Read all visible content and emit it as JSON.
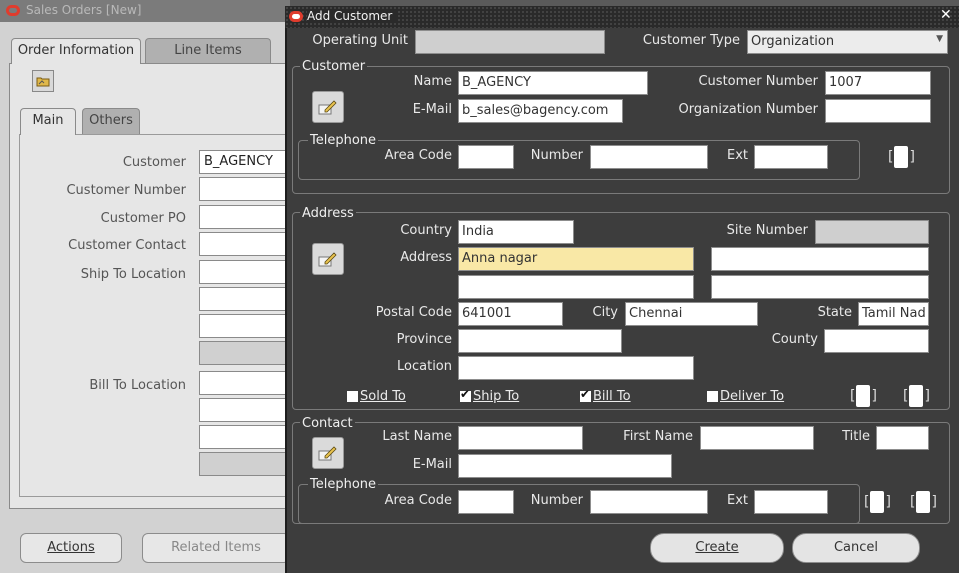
{
  "background_window": {
    "title": "Sales Orders [New]",
    "tabs": [
      "Order Information",
      "Line Items"
    ],
    "sub_tabs": [
      "Main",
      "Others"
    ],
    "labels": {
      "customer": "Customer",
      "customer_number": "Customer Number",
      "customer_po": "Customer PO",
      "customer_contact": "Customer Contact",
      "ship_to_location": "Ship To Location",
      "bill_to_location": "Bill To Location"
    },
    "values": {
      "customer": "B_AGENCY"
    },
    "buttons": {
      "actions": "Actions",
      "related_items": "Related Items"
    }
  },
  "dialog": {
    "title": "Add Customer",
    "operating_unit": {
      "label": "Operating Unit",
      "value": ""
    },
    "customer_type": {
      "label": "Customer Type",
      "value": "Organization"
    },
    "customer": {
      "group_title": "Customer",
      "name": {
        "label": "Name",
        "value": "B_AGENCY"
      },
      "email": {
        "label": "E-Mail",
        "value": "b_sales@bagency.com"
      },
      "customer_number": {
        "label": "Customer Number",
        "value": "1007"
      },
      "organization_number": {
        "label": "Organization Number",
        "value": ""
      },
      "telephone": {
        "group_title": "Telephone",
        "area_code": "Area Code",
        "number": "Number",
        "ext": "Ext"
      }
    },
    "address": {
      "group_title": "Address",
      "country": {
        "label": "Country",
        "value": "India"
      },
      "site_number": {
        "label": "Site Number",
        "value": ""
      },
      "address": {
        "label": "Address",
        "value": "Anna nagar"
      },
      "postal_code": {
        "label": "Postal Code",
        "value": "641001"
      },
      "city": {
        "label": "City",
        "value": "Chennai"
      },
      "state": {
        "label": "State",
        "value": "Tamil Nad"
      },
      "province": {
        "label": "Province",
        "value": ""
      },
      "county": {
        "label": "County",
        "value": ""
      },
      "location": {
        "label": "Location",
        "value": ""
      },
      "checkboxes": {
        "sold_to": {
          "label": "Sold To",
          "checked": false
        },
        "ship_to": {
          "label": "Ship To",
          "checked": true
        },
        "bill_to": {
          "label": "Bill To",
          "checked": true
        },
        "deliver_to": {
          "label": "Deliver To",
          "checked": false
        }
      }
    },
    "contact": {
      "group_title": "Contact",
      "last_name": "Last Name",
      "first_name": "First Name",
      "title": "Title",
      "email": "E-Mail",
      "telephone": {
        "group_title": "Telephone",
        "area_code": "Area Code",
        "number": "Number",
        "ext": "Ext"
      }
    },
    "buttons": {
      "create": "Create",
      "cancel": "Cancel"
    }
  },
  "colors": {
    "dialog_bg": "#3d3d3d",
    "highlight_field": "#f9e8a6",
    "oracle_red": "#e03c2d"
  },
  "icons": [
    "oracle-logo-icon",
    "folder-icon",
    "edit-pencil-icon",
    "close-icon",
    "dropdown-arrow-icon"
  ]
}
